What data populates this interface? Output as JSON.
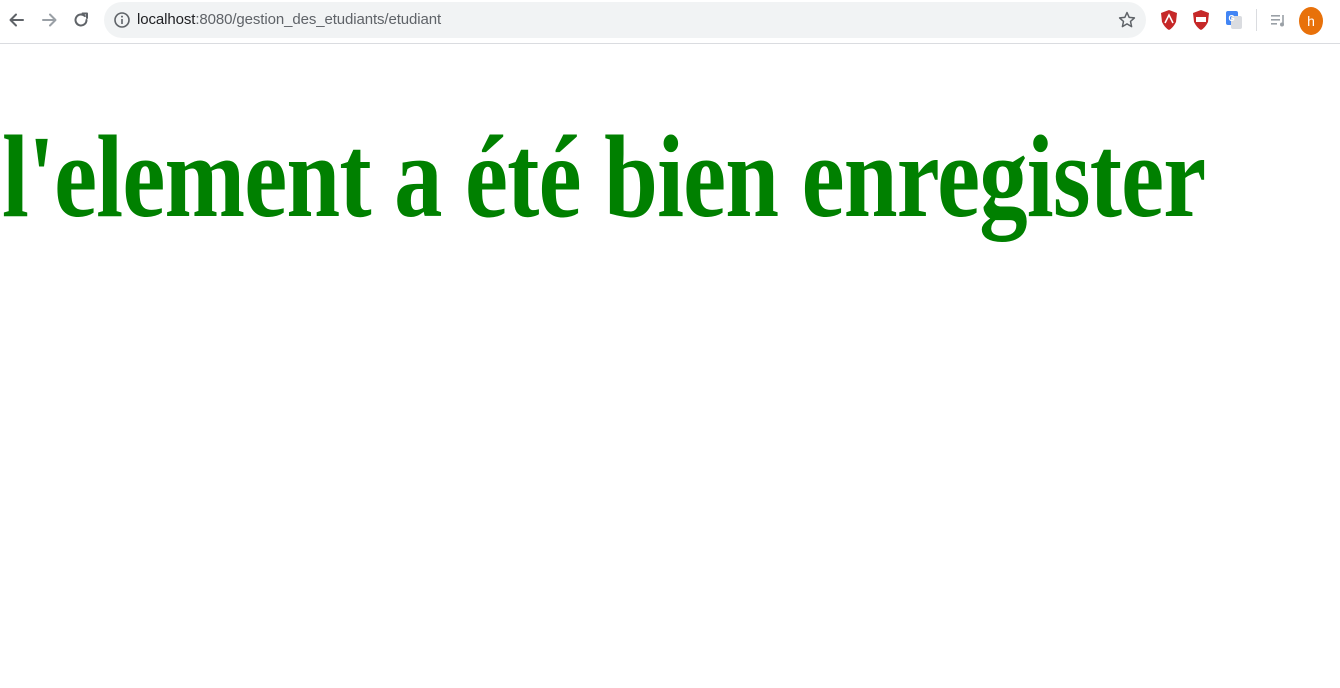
{
  "browser": {
    "url_host": "localhost",
    "url_path": ":8080/gestion_des_etudiants/etudiant",
    "profile_initial": "h",
    "icons": {
      "back": "arrow-left-icon",
      "forward": "arrow-right-icon",
      "reload": "reload-icon",
      "site_info": "info-icon",
      "bookmark": "star-icon",
      "ext1": "adblock-shield-icon",
      "ext2": "adblock-shield-icon",
      "ext3": "google-translate-icon",
      "media": "playlist-icon"
    },
    "colors": {
      "avatar": "#e8710a",
      "omnibox": "#f1f3f4"
    }
  },
  "page": {
    "message": "l'element a été bien enregister",
    "message_color": "#008000"
  }
}
